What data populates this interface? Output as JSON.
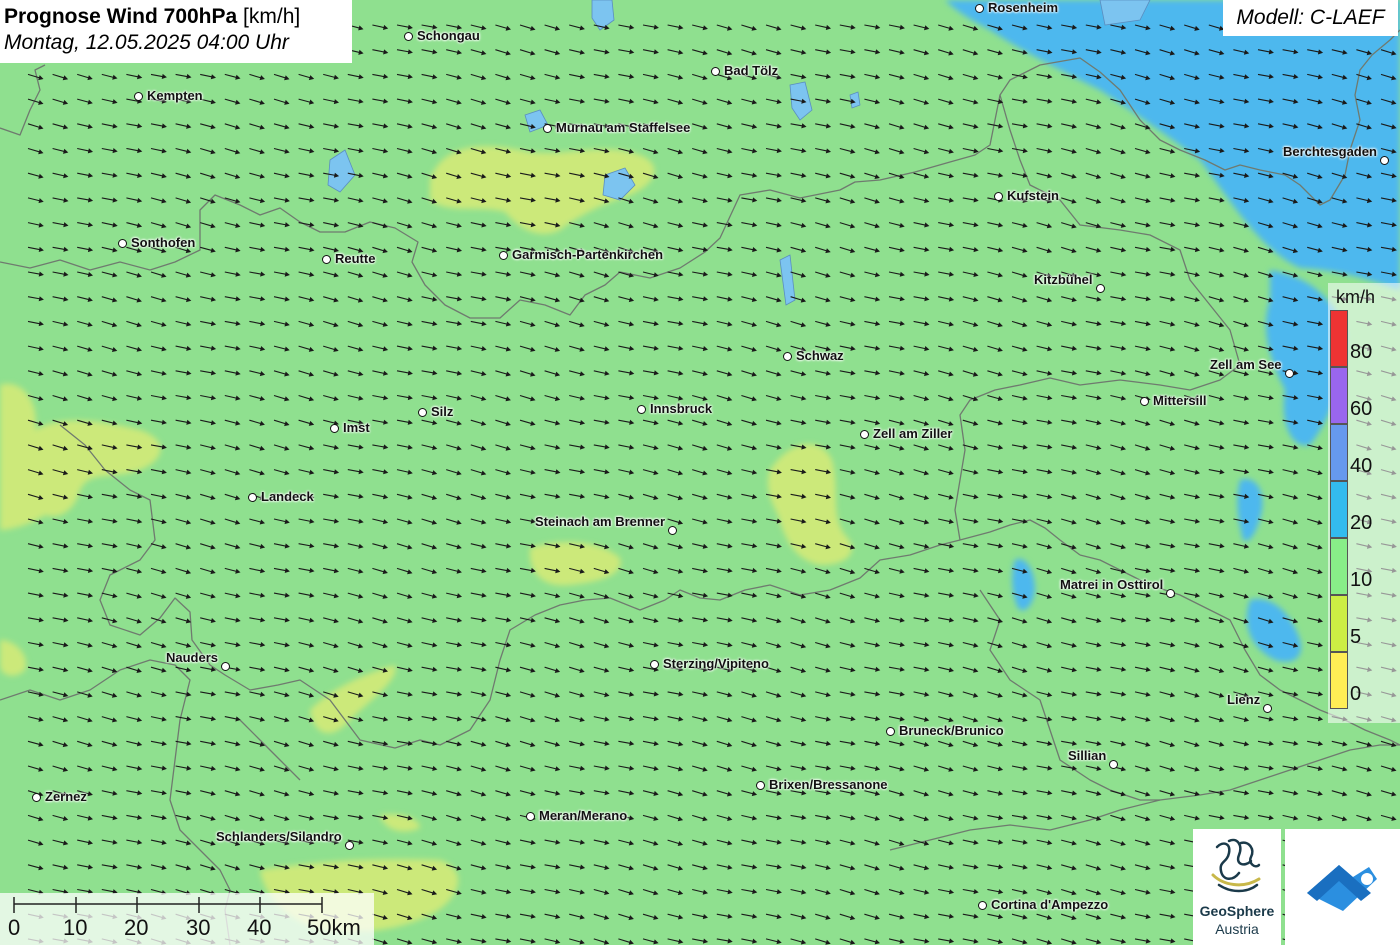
{
  "header": {
    "title": "Prognose Wind 700hPa",
    "unit": "[km/h]",
    "datetime": "Montag, 12.05.2025 04:00 Uhr",
    "model": "Modell: C-LAEF"
  },
  "legend": {
    "unit": "km/h",
    "labels": [
      "80",
      "60",
      "40",
      "20",
      "10",
      "5",
      "0"
    ],
    "colors": [
      "#ee3333",
      "#9966ee",
      "#6699ee",
      "#33bbee",
      "#88ee88",
      "#ccee44",
      "#ffee55"
    ]
  },
  "scalebar": {
    "labels": [
      "0",
      "10",
      "20",
      "30",
      "40",
      "50km"
    ]
  },
  "logos": {
    "geosphere_line1": "GeoSphere",
    "geosphere_line2": "Austria",
    "geosphere_icon": "geosphere-logo-icon",
    "app_icon": "weather-app-icon"
  },
  "wind_field": {
    "direction": "east-southeast",
    "arrow_icon": "wind-arrow-icon"
  },
  "colors": {
    "base": "#8fe08f",
    "weak": "#cce97a",
    "strong": "#4db8ee",
    "border": "#6f7a6f"
  },
  "cities": [
    {
      "name": "Schongau"
    },
    {
      "name": "Kempten"
    },
    {
      "name": "Bad Tölz"
    },
    {
      "name": "Rosenheim"
    },
    {
      "name": "Murnau am Staffelsee"
    },
    {
      "name": "Berchtesgaden"
    },
    {
      "name": "Kufstein"
    },
    {
      "name": "Sonthofen"
    },
    {
      "name": "Reutte"
    },
    {
      "name": "Garmisch-Partenkirchen"
    },
    {
      "name": "Kitzbühel"
    },
    {
      "name": "Schwaz"
    },
    {
      "name": "Zell am See"
    },
    {
      "name": "Mittersill"
    },
    {
      "name": "Silz"
    },
    {
      "name": "Innsbruck"
    },
    {
      "name": "Imst"
    },
    {
      "name": "Zell am Ziller"
    },
    {
      "name": "Landeck"
    },
    {
      "name": "Steinach am Brenner"
    },
    {
      "name": "Matrei in Osttirol"
    },
    {
      "name": "Nauders"
    },
    {
      "name": "Sterzing/Vipiteno"
    },
    {
      "name": "Lienz"
    },
    {
      "name": "Bruneck/Brunico"
    },
    {
      "name": "Sillian"
    },
    {
      "name": "Brixen/Bressanone"
    },
    {
      "name": "Zernez"
    },
    {
      "name": "Meran/Merano"
    },
    {
      "name": "Schlanders/Silandro"
    },
    {
      "name": "Cortina d'Ampezzo"
    }
  ]
}
